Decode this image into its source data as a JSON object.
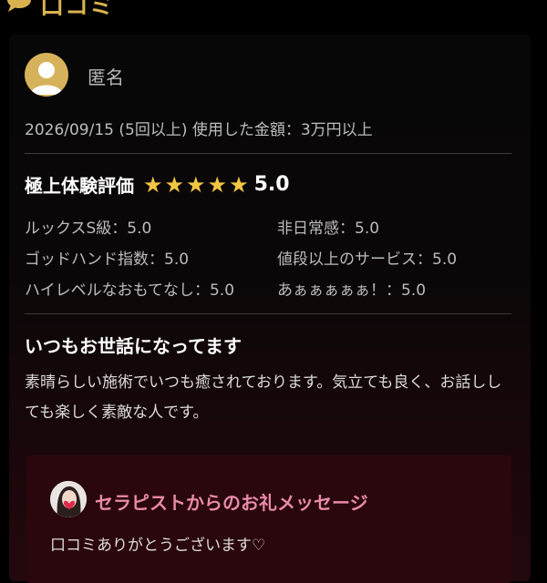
{
  "header": {
    "title": "口コミ",
    "icon": "speech-bubble-icon"
  },
  "review": {
    "reviewer": "匿名",
    "meta": "2026/09/15 (5回以上) 使用した金額：3万円以上",
    "rating": {
      "title": "極上体験評価",
      "stars": 5,
      "score": "5.0",
      "items": [
        "ルックスS級：5.0",
        "非日常感：5.0",
        "ゴッドハンド指数：5.0",
        "値段以上のサービス：5.0",
        "ハイレベルなおもてなし：5.0",
        "あぁぁぁぁぁ！：5.0"
      ]
    },
    "title": "いつもお世話になってます",
    "body": "素晴らしい施術でいつも癒されております。気立ても良く、お話ししても楽しく素敵な人です。"
  },
  "thanks": {
    "title": "セラピストからのお礼メッセージ",
    "message": "口コミありがとうございます♡"
  },
  "colors": {
    "accent_gold": "#d9b24f",
    "star": "#f3c542",
    "thanks_pink": "#e88aa9"
  }
}
